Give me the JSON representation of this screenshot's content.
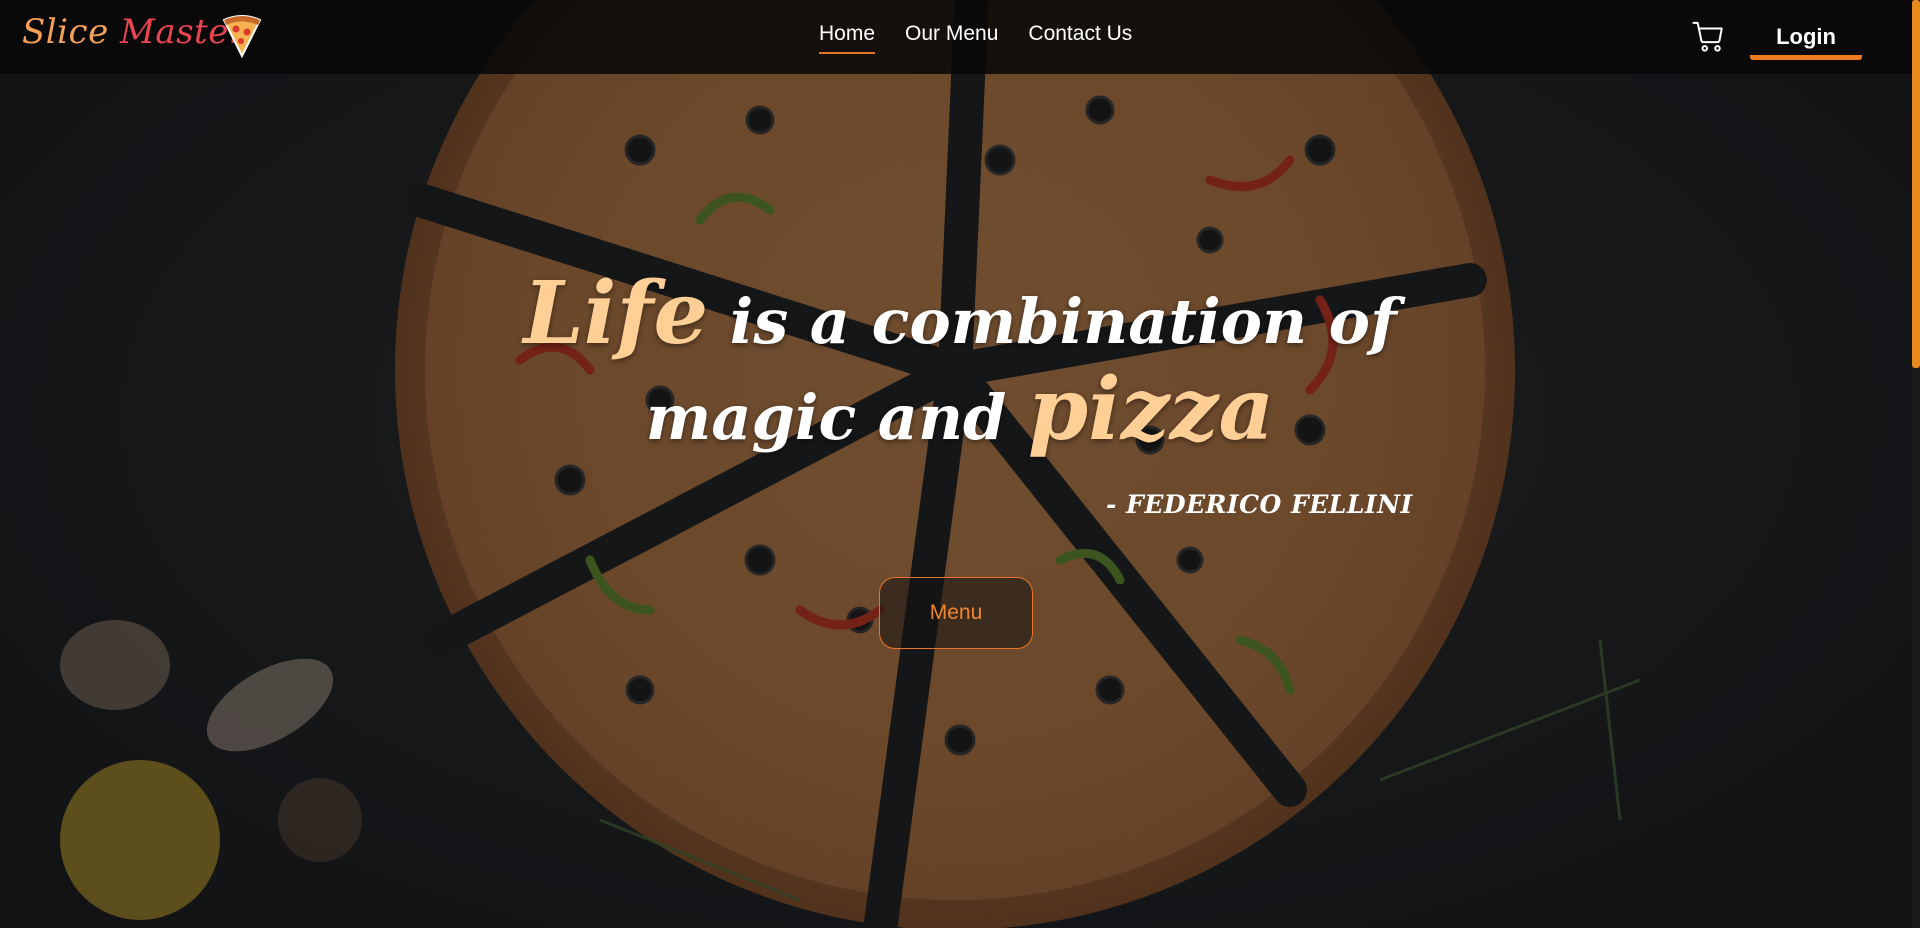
{
  "brand": {
    "word1": "Slice",
    "word2": "Master",
    "logo_icon": "pizza-slice-icon"
  },
  "nav": {
    "links": [
      {
        "label": "Home",
        "active": true
      },
      {
        "label": "Our Menu",
        "active": false
      },
      {
        "label": "Contact Us",
        "active": false
      }
    ],
    "cart_icon": "cart-icon",
    "login_label": "Login"
  },
  "hero": {
    "quote": {
      "highlight_1": "Life",
      "middle_1": "is a combination of",
      "middle_2": "magic and",
      "highlight_2": "pizza"
    },
    "author": "- FEDERICO FELLINI",
    "menu_button_label": "Menu",
    "background_image": "pizza-on-dark-table"
  },
  "colors": {
    "accent_orange": "#e8742a",
    "highlight_peach": "#ffcf96",
    "logo_red": "#e9444f",
    "logo_orange": "#f5a15a",
    "navbar_bg": "#080808"
  }
}
